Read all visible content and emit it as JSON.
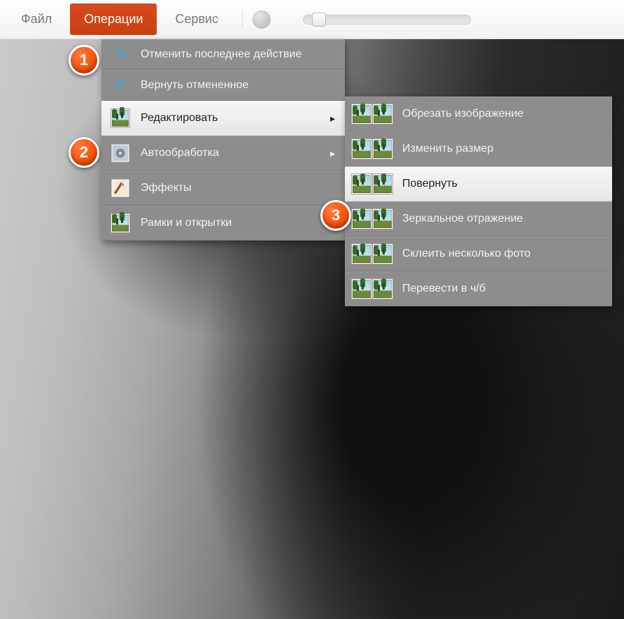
{
  "toolbar": {
    "file": "Файл",
    "operations": "Операции",
    "service": "Сервис"
  },
  "menu": {
    "undo": "Отменить последнее действие",
    "redo": "Вернуть отмененное",
    "edit": "Редактировать",
    "auto": "Автообработка",
    "effects": "Эффекты",
    "frames": "Рамки и открытки"
  },
  "submenu": {
    "crop": "Обрезать изображение",
    "resize": "Изменить размер",
    "rotate": "Повернуть",
    "mirror": "Зеркальное отражение",
    "stitch": "Склеить несколько фото",
    "bw": "Перевести в ч/б"
  },
  "callouts": {
    "one": "1",
    "two": "2",
    "three": "3"
  }
}
